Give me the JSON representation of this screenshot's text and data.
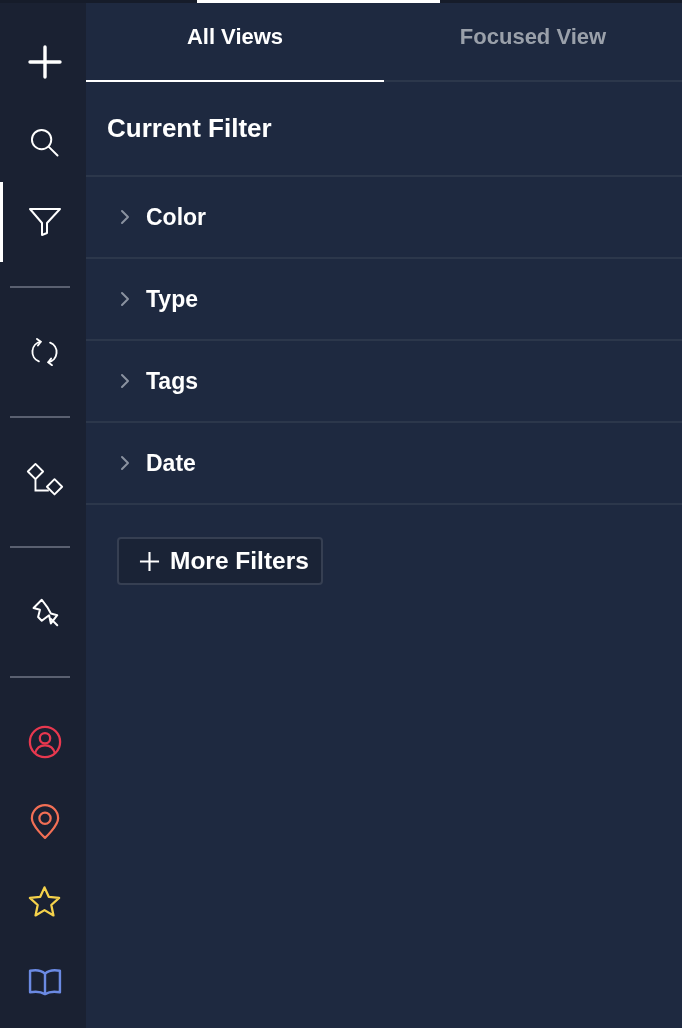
{
  "sidebar": {
    "groups": [
      {
        "items": [
          {
            "selected": false
          },
          {
            "selected": false
          },
          {
            "selected": true
          }
        ]
      },
      {
        "items": [
          {
            "selected": false
          }
        ]
      },
      {
        "items": [
          {
            "selected": false
          }
        ]
      },
      {
        "items": [
          {
            "selected": false
          }
        ]
      },
      {
        "items": [
          {
            "selected": false,
            "color": "#e8384f"
          },
          {
            "selected": false,
            "color": "#f26f55"
          },
          {
            "selected": false,
            "color": "#f5d24b"
          },
          {
            "selected": false,
            "color": "#6b8ae3"
          }
        ]
      }
    ]
  },
  "tabs": [
    {
      "label": "All Views",
      "selected": true
    },
    {
      "label": "Focused View",
      "selected": false
    }
  ],
  "filter_panel": {
    "title": "Current Filter",
    "sections": [
      {
        "label": "Color",
        "expanded": false
      },
      {
        "label": "Type",
        "expanded": false
      },
      {
        "label": "Tags",
        "expanded": false
      },
      {
        "label": "Date",
        "expanded": false
      }
    ],
    "add_button": {
      "label": "More Filters"
    }
  }
}
